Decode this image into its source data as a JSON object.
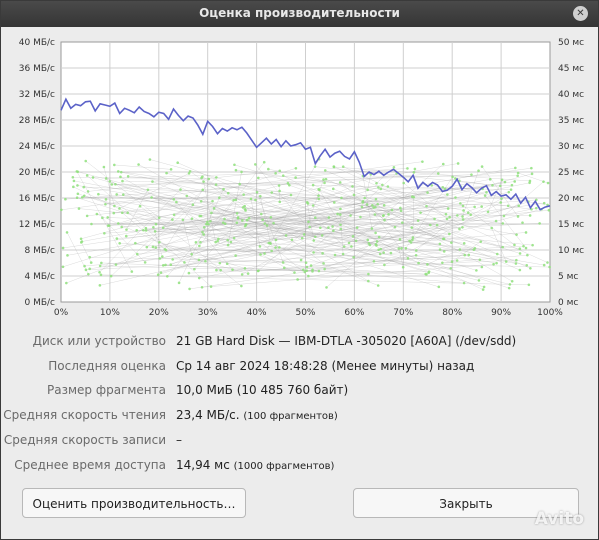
{
  "window": {
    "title": "Оценка производительности"
  },
  "chart_data": {
    "type": "line",
    "y_left_ticks": [
      "40 МБ/с",
      "36 МБ/с",
      "32 МБ/с",
      "28 МБ/с",
      "24 МБ/с",
      "20 МБ/с",
      "16 МБ/с",
      "12 МБ/с",
      "8 МБ/с",
      "4 МБ/с",
      "0 МБ/с"
    ],
    "y_right_ticks": [
      "50 мс",
      "45 мс",
      "40 мс",
      "35 мс",
      "30 мс",
      "25 мс",
      "20 мс",
      "15 мс",
      "10 мс",
      "5 мс",
      "0 мс"
    ],
    "x_ticks": [
      "0%",
      "10%",
      "20%",
      "30%",
      "40%",
      "50%",
      "60%",
      "70%",
      "80%",
      "90%",
      "100%"
    ],
    "ylim": [
      0,
      40
    ],
    "y2lim": [
      0,
      50
    ],
    "xlim": [
      0,
      100
    ],
    "grid": true,
    "series": [
      {
        "role": "read-rate",
        "color": "#5b62c8",
        "x": [
          0,
          1,
          2,
          3,
          4,
          5,
          6,
          7,
          8,
          9,
          10,
          11,
          12,
          13,
          14,
          15,
          16,
          17,
          18,
          19,
          20,
          21,
          22,
          23,
          24,
          25,
          26,
          27,
          28,
          29,
          30,
          31,
          32,
          33,
          34,
          35,
          36,
          37,
          38,
          39,
          40,
          41,
          42,
          43,
          44,
          45,
          46,
          47,
          48,
          49,
          50,
          51,
          52,
          53,
          54,
          55,
          56,
          57,
          58,
          59,
          60,
          61,
          62,
          63,
          64,
          65,
          66,
          67,
          68,
          69,
          70,
          71,
          72,
          73,
          74,
          75,
          76,
          77,
          78,
          79,
          80,
          81,
          82,
          83,
          84,
          85,
          86,
          87,
          88,
          89,
          90,
          91,
          92,
          93,
          94,
          95,
          96,
          97,
          98,
          99,
          100
        ],
        "y": [
          29.5,
          31.2,
          29.8,
          30.4,
          30.2,
          30.8,
          30.9,
          29.4,
          30.5,
          30.3,
          30.1,
          30.6,
          29.0,
          29.8,
          29.5,
          29.1,
          30.0,
          29.3,
          29.0,
          28.5,
          29.2,
          29.0,
          28.1,
          29.7,
          28.7,
          27.9,
          28.6,
          28.3,
          27.2,
          25.8,
          27.8,
          27.0,
          25.9,
          26.7,
          26.3,
          26.8,
          26.5,
          26.9,
          26.0,
          24.9,
          23.8,
          24.5,
          25.2,
          24.3,
          25.0,
          23.9,
          24.8,
          24.0,
          24.2,
          24.5,
          23.5,
          23.8,
          21.3,
          22.5,
          23.5,
          22.3,
          22.9,
          23.2,
          22.4,
          22.0,
          23.1,
          21.5,
          19.3,
          20.0,
          19.6,
          20.1,
          19.5,
          20.0,
          20.4,
          19.8,
          19.2,
          18.5,
          19.5,
          17.5,
          18.4,
          17.8,
          18.4,
          18.0,
          17.0,
          17.2,
          17.8,
          18.9,
          17.3,
          18.2,
          17.6,
          16.8,
          17.5,
          17.9,
          16.4,
          17.0,
          16.3,
          16.5,
          15.8,
          16.6,
          15.2,
          16.1,
          14.5,
          15.5,
          14.2,
          14.6,
          14.8
        ]
      }
    ]
  },
  "details": [
    {
      "label": "Диск или устройство",
      "value": "21 GB Hard Disk — IBM-DTLA -305020 [A60A] (/dev/sdd)",
      "note": ""
    },
    {
      "label": "Последняя оценка",
      "value": "Ср 14 авг 2024 18:48:28 (Менее минуты) назад",
      "note": ""
    },
    {
      "label": "Размер фрагмента",
      "value": "10,0 МиБ (10 485 760 байт)",
      "note": ""
    },
    {
      "label": "Средняя скорость чтения",
      "value": "23,4 МБ/с.",
      "note": "(100 фрагментов)"
    },
    {
      "label": "Средняя скорость записи",
      "value": "–",
      "note": ""
    },
    {
      "label": "Среднее время доступа",
      "value": "14,94 мс",
      "note": "(1000 фрагментов)"
    }
  ],
  "buttons": {
    "benchmark": "Оценить производительность…",
    "close": "Закрыть"
  },
  "watermark": "Avito"
}
